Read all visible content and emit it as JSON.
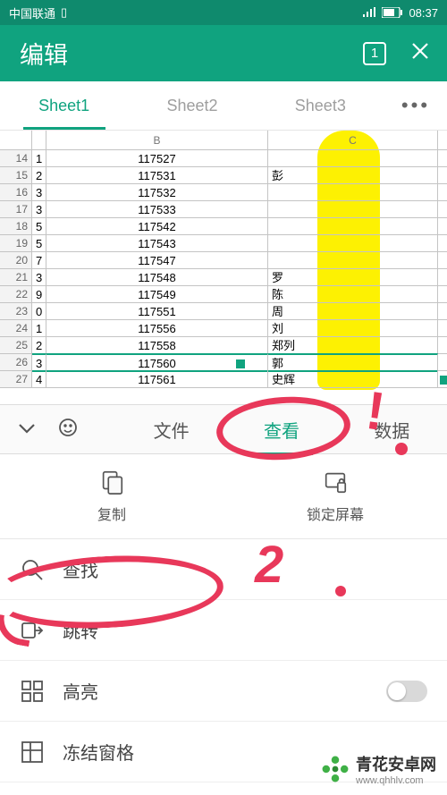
{
  "status": {
    "carrier": "中国联通",
    "time": "08:37"
  },
  "titlebar": {
    "title": "编辑",
    "tab_count": "1"
  },
  "sheets": {
    "tabs": [
      "Sheet1",
      "Sheet2",
      "Sheet3"
    ],
    "active": 0
  },
  "grid": {
    "columns": [
      "",
      "B",
      "C"
    ],
    "rows": [
      {
        "n": "14",
        "a": "1",
        "b": "117527",
        "c": ""
      },
      {
        "n": "15",
        "a": "2",
        "b": "117531",
        "c": "彭"
      },
      {
        "n": "16",
        "a": "3",
        "b": "117532",
        "c": ""
      },
      {
        "n": "17",
        "a": "3",
        "b": "117533",
        "c": ""
      },
      {
        "n": "18",
        "a": "5",
        "b": "117542",
        "c": ""
      },
      {
        "n": "19",
        "a": "5",
        "b": "117543",
        "c": ""
      },
      {
        "n": "20",
        "a": "7",
        "b": "117547",
        "c": ""
      },
      {
        "n": "21",
        "a": "3",
        "b": "117548",
        "c": "罗"
      },
      {
        "n": "22",
        "a": "9",
        "b": "117549",
        "c": "陈"
      },
      {
        "n": "23",
        "a": "0",
        "b": "117551",
        "c": "周"
      },
      {
        "n": "24",
        "a": "1",
        "b": "117556",
        "c": "刘"
      },
      {
        "n": "25",
        "a": "2",
        "b": "117558",
        "c": "郑列"
      },
      {
        "n": "26",
        "a": "3",
        "b": "117560",
        "c": "郭",
        "selected": true
      },
      {
        "n": "27",
        "a": "4",
        "b": "117561",
        "c": "史辉"
      }
    ]
  },
  "menu": {
    "items": [
      "文件",
      "查看",
      "数据"
    ],
    "active": 1
  },
  "actions": {
    "copy": "复制",
    "lock": "锁定屏幕"
  },
  "list": {
    "search": "查找",
    "jump": "跳转",
    "highlight": "高亮",
    "freeze": "冻结窗格"
  },
  "watermark": {
    "brand": "青花安卓网",
    "url": "www.qhhlv.com"
  }
}
